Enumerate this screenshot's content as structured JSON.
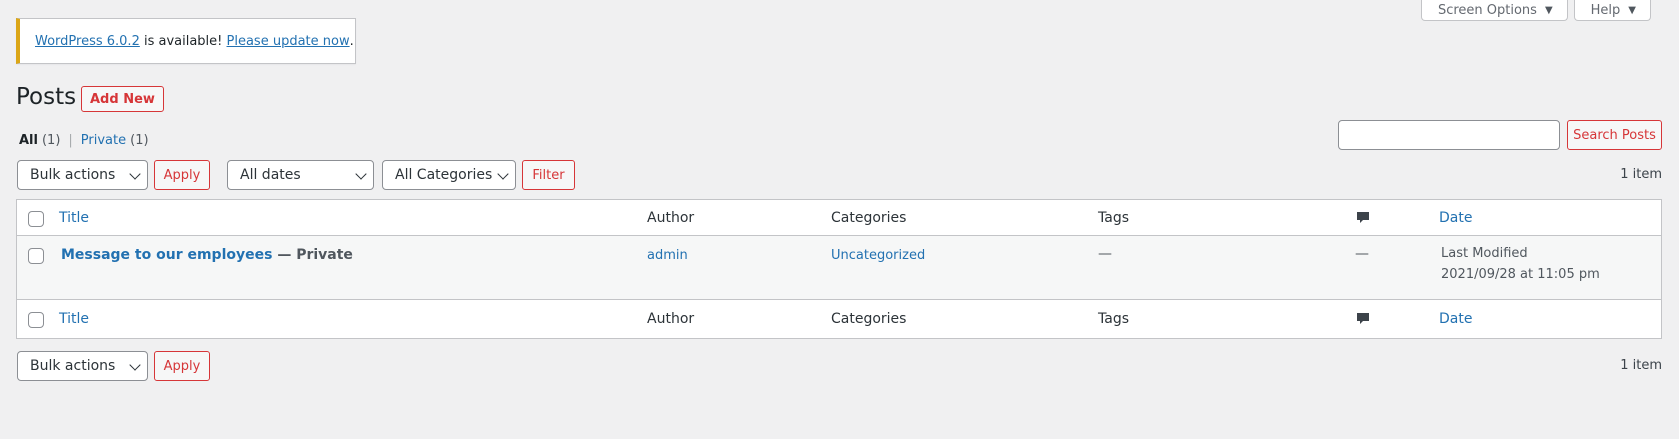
{
  "screen_meta": {
    "screen_options_label": "Screen Options",
    "help_label": "Help"
  },
  "notice": {
    "version_link": "WordPress 6.0.2",
    "middle_text": " is available! ",
    "update_link": "Please update now",
    "end_text": "."
  },
  "page": {
    "title": "Posts",
    "add_new_label": "Add New"
  },
  "filters_links": {
    "all_label": "All",
    "all_count": "(1)",
    "separator": "|",
    "private_label": "Private",
    "private_count": "(1)"
  },
  "search": {
    "placeholder": "",
    "button_label": "Search Posts"
  },
  "tablenav_top": {
    "bulk_actions": "Bulk actions",
    "apply_label": "Apply",
    "dates_filter": "All dates",
    "categories_filter": "All Categories",
    "filter_label": "Filter",
    "items_count": "1 item"
  },
  "table": {
    "columns": {
      "title": "Title",
      "author": "Author",
      "categories": "Categories",
      "tags": "Tags",
      "comments_icon": "comment-bubble-icon",
      "date": "Date"
    },
    "rows": [
      {
        "title": "Message to our employees",
        "state": " — Private",
        "author": "admin",
        "categories": "Uncategorized",
        "tags": "—",
        "comments": "—",
        "date_status": "Last Modified",
        "date_value": "2021/09/28 at 11:05 pm"
      }
    ]
  },
  "tablenav_bottom": {
    "bulk_actions": "Bulk actions",
    "apply_label": "Apply",
    "items_count": "1 item"
  },
  "colors": {
    "link": "#2271b1",
    "accent_red": "#d63638",
    "notice_border": "#dba617",
    "background": "#f0f0f1"
  }
}
